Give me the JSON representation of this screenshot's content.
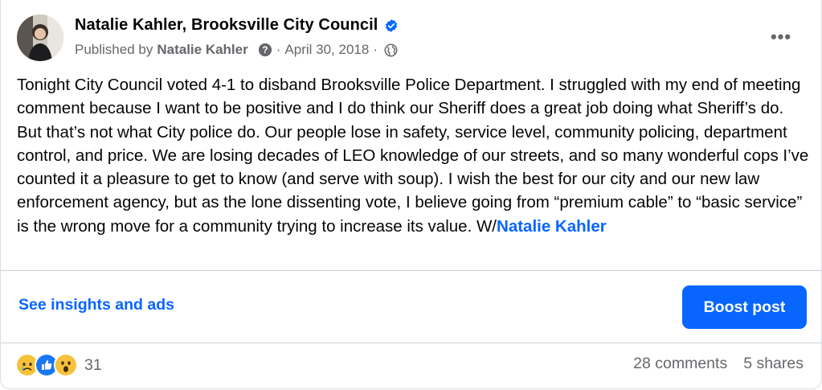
{
  "post": {
    "author_name": "Natalie Kahler, Brooksville City Council",
    "published_by_prefix": "Published by",
    "published_by_name": "Natalie Kahler",
    "separator": "·",
    "date": "April 30, 2018",
    "more_label": "•••",
    "body_text": "Tonight City Council voted 4-1 to disband Brooksville Police Department. I struggled with my end of meeting comment because I want to be positive and I do think our Sheriff does a great job doing what Sheriff’s do. But that’s not what City police do. Our  people lose in safety, service level, community policing, department control, and price. We are losing decades of LEO knowledge of our streets, and so many wonderful cops I’ve counted it a pleasure to get to know (and serve with soup).  I wish the best for our city and our new law enforcement agency, but as the lone dissenting vote, I believe going from “premium cable” to “basic service” is the wrong move for a community trying to increase its value. W/",
    "body_link": "Natalie Kahler"
  },
  "actions": {
    "insights_label": "See insights and ads",
    "boost_label": "Boost post"
  },
  "engagement": {
    "reaction_icons": [
      "sad-reaction-icon",
      "like-reaction-icon",
      "wow-reaction-icon"
    ],
    "reaction_count": "31",
    "comments": "28 comments",
    "shares": "5 shares"
  },
  "colors": {
    "accent": "#0866ff",
    "secondary_text": "#65676b",
    "divider": "#ced0d4"
  }
}
